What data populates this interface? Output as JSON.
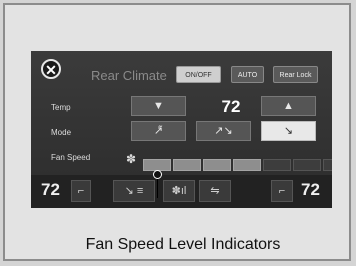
{
  "panel": {
    "title": "Rear Climate",
    "close_icon": "close-icon",
    "onoff_label": "ON/OFF",
    "auto_label": "AUTO",
    "rear_lock_label": "Rear Lock"
  },
  "temp_row": {
    "label": "Temp",
    "down_glyph": "▼",
    "value": "72",
    "up_glyph": "▲"
  },
  "mode_row": {
    "label": "Mode",
    "options": [
      "face-icon",
      "bi-level-icon",
      "floor-icon"
    ],
    "selected_index": 2
  },
  "fan_row": {
    "label": "Fan Speed",
    "icon": "fan-icon",
    "levels_total": 7,
    "level_current": 4
  },
  "bottom": {
    "left_temp": "72",
    "right_temp": "72"
  },
  "caption": "Fan Speed Level Indicators",
  "colors": {
    "background": "#e3e3e3",
    "screen": "#2f2f2f",
    "selected_button": "#e8e8e8"
  }
}
